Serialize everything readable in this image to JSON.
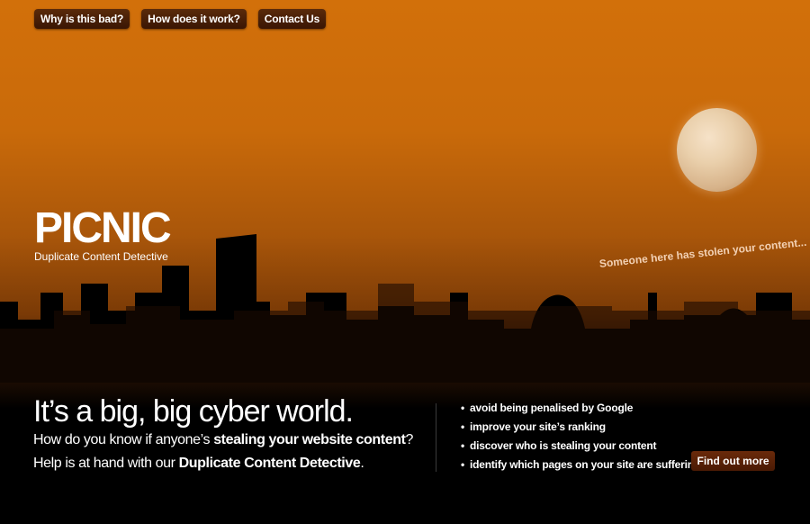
{
  "nav": {
    "items": [
      {
        "label": "Why is this bad?"
      },
      {
        "label": "How does it work?"
      },
      {
        "label": "Contact Us"
      }
    ]
  },
  "logo": {
    "word": "PICNIC",
    "tagline": "Duplicate Content Detective"
  },
  "callout": "Someone here has stolen your content...",
  "hero": {
    "headline": "It’s a big, big cyber world.",
    "line1_pre": "How do you know if anyone’s ",
    "line1_bold": "stealing your website content",
    "line1_post": "?",
    "line2_pre": "Help is at hand with our ",
    "line2_bold": "Duplicate Content Detective",
    "line2_post": "."
  },
  "features": [
    "avoid being penalised by Google",
    "improve your site’s ranking",
    "discover who is stealing your content",
    "identify which pages on your site are suffering"
  ],
  "cta": {
    "label": "Find out more"
  },
  "colors": {
    "sky_top": "#d2700a",
    "button": "#4a1a04",
    "moon": "#ead0ac"
  }
}
